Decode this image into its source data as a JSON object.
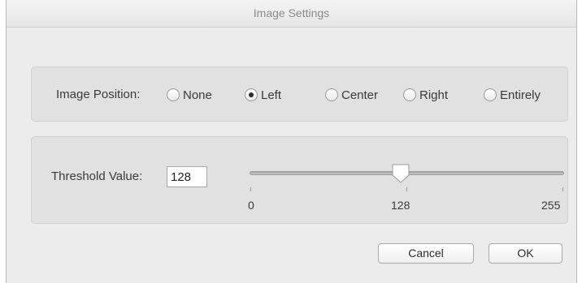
{
  "window": {
    "title": "Image Settings"
  },
  "image_position": {
    "label": "Image Position:",
    "options": [
      {
        "label": "None",
        "selected": false
      },
      {
        "label": "Left",
        "selected": true
      },
      {
        "label": "Center",
        "selected": false
      },
      {
        "label": "Right",
        "selected": false
      },
      {
        "label": "Entirely",
        "selected": false
      }
    ]
  },
  "threshold": {
    "label": "Threshold Value:",
    "value": "128",
    "slider": {
      "min": 0,
      "max": 255,
      "value": 128
    },
    "tick_labels": [
      "0",
      "128",
      "255"
    ]
  },
  "buttons": {
    "cancel": "Cancel",
    "ok": "OK"
  }
}
